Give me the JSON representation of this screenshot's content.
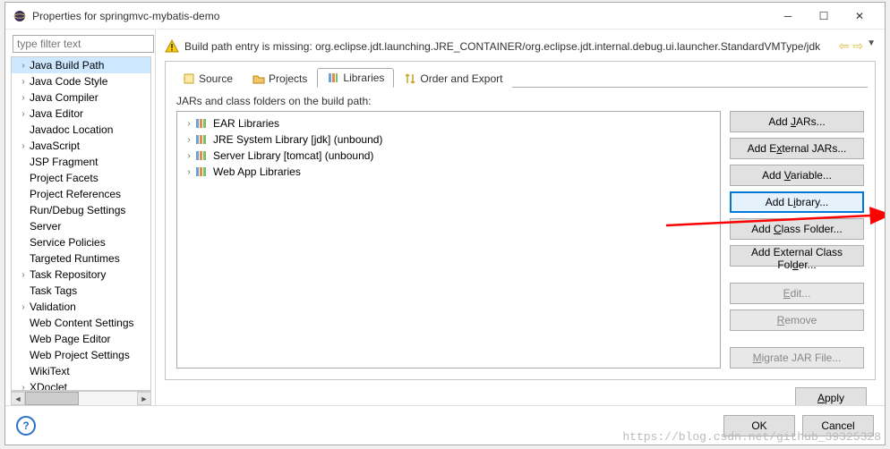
{
  "window": {
    "title": "Properties for springmvc-mybatis-demo"
  },
  "filter_placeholder": "type filter text",
  "sidebar": {
    "items": [
      {
        "label": "Java Build Path",
        "expandable": true,
        "selected": true,
        "level": 1
      },
      {
        "label": "Java Code Style",
        "expandable": true,
        "level": 1
      },
      {
        "label": "Java Compiler",
        "expandable": true,
        "level": 1
      },
      {
        "label": "Java Editor",
        "expandable": true,
        "level": 1
      },
      {
        "label": "Javadoc Location",
        "expandable": false,
        "level": 1
      },
      {
        "label": "JavaScript",
        "expandable": true,
        "level": 1
      },
      {
        "label": "JSP Fragment",
        "expandable": false,
        "level": 1
      },
      {
        "label": "Project Facets",
        "expandable": false,
        "level": 1
      },
      {
        "label": "Project References",
        "expandable": false,
        "level": 1
      },
      {
        "label": "Run/Debug Settings",
        "expandable": false,
        "level": 1
      },
      {
        "label": "Server",
        "expandable": false,
        "level": 1
      },
      {
        "label": "Service Policies",
        "expandable": false,
        "level": 1
      },
      {
        "label": "Targeted Runtimes",
        "expandable": false,
        "level": 1
      },
      {
        "label": "Task Repository",
        "expandable": true,
        "level": 1
      },
      {
        "label": "Task Tags",
        "expandable": false,
        "level": 1
      },
      {
        "label": "Validation",
        "expandable": true,
        "level": 1
      },
      {
        "label": "Web Content Settings",
        "expandable": false,
        "level": 1
      },
      {
        "label": "Web Page Editor",
        "expandable": false,
        "level": 1
      },
      {
        "label": "Web Project Settings",
        "expandable": false,
        "level": 1
      },
      {
        "label": "WikiText",
        "expandable": false,
        "level": 1
      },
      {
        "label": "XDoclet",
        "expandable": true,
        "level": 1
      }
    ]
  },
  "warning": "Build path entry is missing: org.eclipse.jdt.launching.JRE_CONTAINER/org.eclipse.jdt.internal.debug.ui.launcher.StandardVMType/jdk",
  "tabs": [
    {
      "label": "Source",
      "icon": "source-icon"
    },
    {
      "label": "Projects",
      "icon": "projects-icon"
    },
    {
      "label": "Libraries",
      "icon": "libraries-icon",
      "active": true
    },
    {
      "label": "Order and Export",
      "icon": "order-icon"
    }
  ],
  "list_label": "JARs and class folders on the build path:",
  "libraries": [
    {
      "label": "EAR Libraries"
    },
    {
      "label": "JRE System Library [jdk] (unbound)"
    },
    {
      "label": "Server Library [tomcat] (unbound)"
    },
    {
      "label": "Web App Libraries"
    }
  ],
  "buttons": {
    "add_jars": {
      "pre": "Add ",
      "u": "J",
      "post": "ARs..."
    },
    "add_ext_jars": {
      "pre": "Add E",
      "u": "x",
      "post": "ternal JARs..."
    },
    "add_variable": {
      "pre": "Add ",
      "u": "V",
      "post": "ariable..."
    },
    "add_library": {
      "pre": "Add L",
      "u": "i",
      "post": "brary..."
    },
    "add_class_folder": {
      "pre": "Add ",
      "u": "C",
      "post": "lass Folder..."
    },
    "add_ext_class_folder": {
      "pre": "Add External Class Fol",
      "u": "d",
      "post": "er..."
    },
    "edit": {
      "pre": "",
      "u": "E",
      "post": "dit..."
    },
    "remove": {
      "pre": "",
      "u": "R",
      "post": "emove"
    },
    "migrate": {
      "pre": "",
      "u": "M",
      "post": "igrate JAR File..."
    },
    "apply": {
      "pre": "",
      "u": "A",
      "post": "pply"
    },
    "ok": "OK",
    "cancel": "Cancel"
  },
  "watermark": "https://blog.csdn.net/github_39325328"
}
